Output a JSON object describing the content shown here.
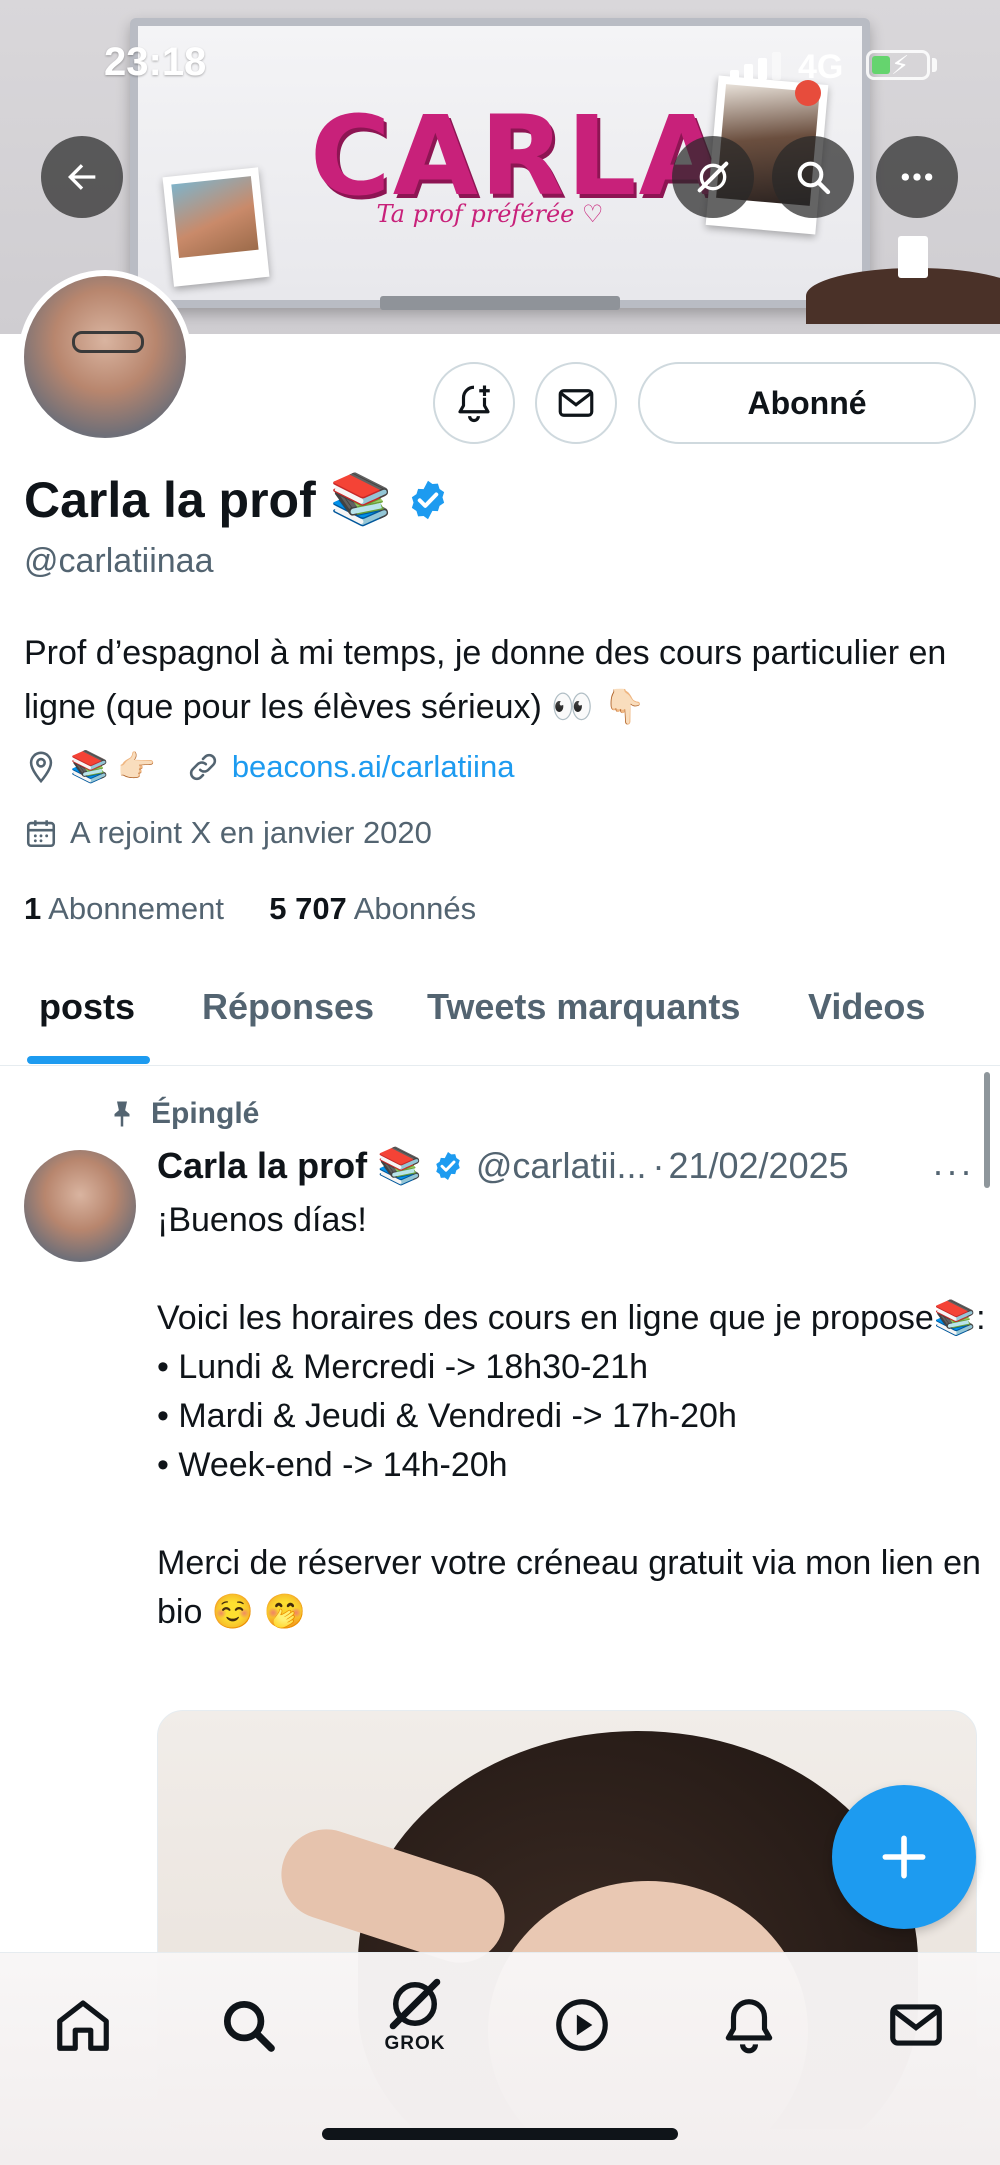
{
  "status_bar": {
    "time": "23:18",
    "network": "4G"
  },
  "banner": {
    "title": "CARLA",
    "subtitle": "Ta prof préférée ♡"
  },
  "profile": {
    "display_name": "Carla la prof",
    "name_emoji": "📚",
    "handle": "@carlatiinaa",
    "bio": "Prof d’espagnol à mi temps, je donne des cours particulier en ligne (que pour les élèves sérieux) 👀 👇🏻",
    "location": "📚 👉🏻",
    "website": "beacons.ai/carlatiina",
    "joined": "A rejoint X en janvier 2020",
    "following_count": "1",
    "following_label": "Abonnement",
    "followers_count": "5 707",
    "followers_label": "Abonnés",
    "follow_button": "Abonné",
    "verified_color": "#1d9bf0"
  },
  "tabs": [
    {
      "label": "posts",
      "active": true
    },
    {
      "label": "Réponses",
      "active": false
    },
    {
      "label": "Tweets marquants",
      "active": false
    },
    {
      "label": "Videos",
      "active": false
    }
  ],
  "pinned_tweet": {
    "pinned_label": "Épinglé",
    "author_name": "Carla la prof",
    "author_emoji": "📚",
    "author_handle": "@carlatii...",
    "date": "21/02/2025",
    "separator": "·",
    "more": "···",
    "text": "¡Buenos días!\n\nVoici les horaires des cours en ligne que je propose📚:\n• Lundi & Mercredi -> 18h30-21h\n• Mardi & Jeudi & Vendredi -> 17h-20h\n• Week-end -> 14h-20h\n\nMerci de réserver votre créneau gratuit via mon lien en bio ☺️ 🤭"
  },
  "bottom_nav": {
    "items": [
      "home-icon",
      "search-icon",
      "grok-icon",
      "video-icon",
      "notifications-icon",
      "messages-icon"
    ],
    "grok_label": "GROK"
  },
  "colors": {
    "accent": "#1d9bf0",
    "text_primary": "#0f1419",
    "text_secondary": "#536471",
    "brand_pink": "#c8217a"
  }
}
